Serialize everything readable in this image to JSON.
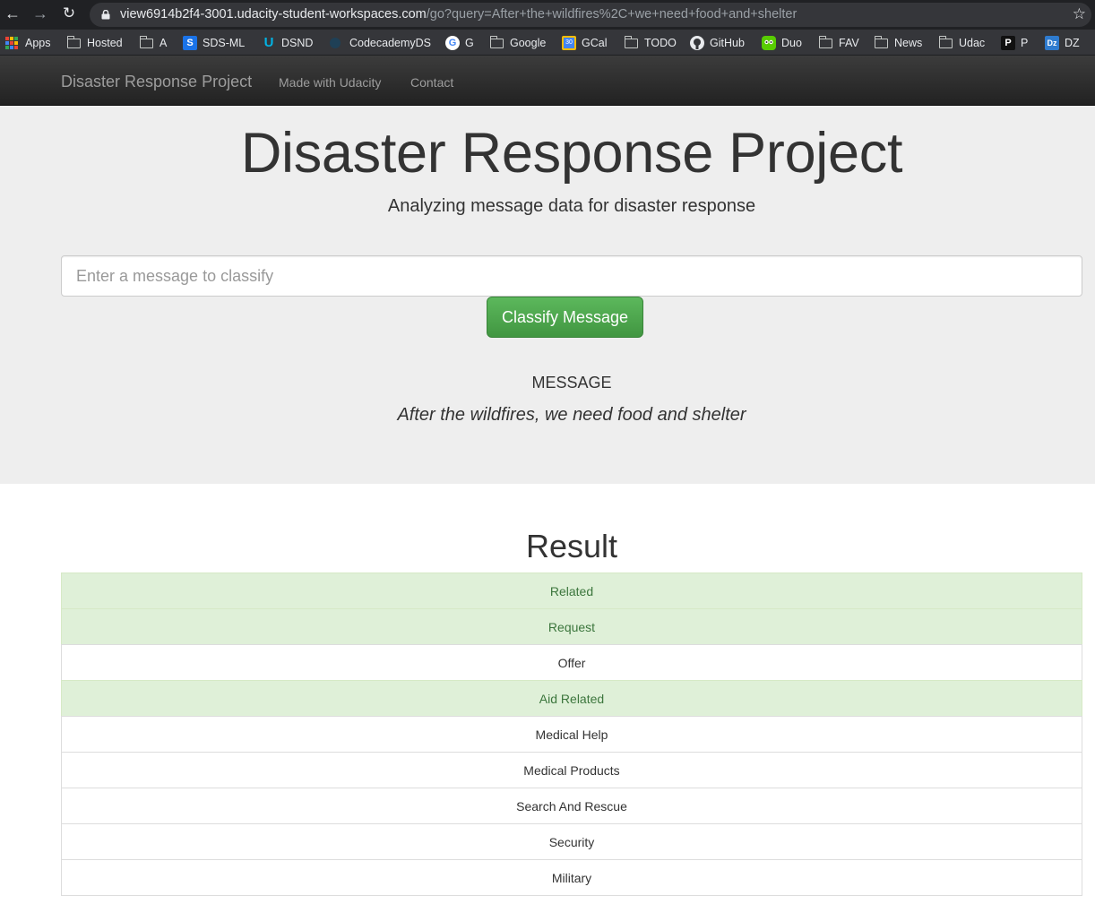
{
  "browser": {
    "url_host": "view6914b2f4-3001.udacity-student-workspaces.com",
    "url_path": "/go?query=After+the+wildfires%2C+we+need+food+and+shelter",
    "bookmarks": [
      {
        "label": "Apps",
        "icon": "apps-grid-icon"
      },
      {
        "label": "Hosted",
        "icon": "folder-icon"
      },
      {
        "label": "A",
        "icon": "folder-icon"
      },
      {
        "label": "SDS-ML",
        "icon": "s-logo-icon"
      },
      {
        "label": "DSND",
        "icon": "udacity-logo-icon"
      },
      {
        "label": "CodecademyDS",
        "icon": "codecademy-logo-icon"
      },
      {
        "label": "G",
        "icon": "google-logo-icon"
      },
      {
        "label": "Google",
        "icon": "folder-icon"
      },
      {
        "label": "GCal",
        "icon": "calendar-icon"
      },
      {
        "label": "TODO",
        "icon": "folder-icon"
      },
      {
        "label": "GitHub",
        "icon": "github-logo-icon"
      },
      {
        "label": "Duo",
        "icon": "duolingo-logo-icon"
      },
      {
        "label": "FAV",
        "icon": "folder-icon"
      },
      {
        "label": "News",
        "icon": "folder-icon"
      },
      {
        "label": "Udac",
        "icon": "folder-icon"
      },
      {
        "label": "P",
        "icon": "p-logo-icon"
      },
      {
        "label": "DZ",
        "icon": "dz-logo-icon"
      }
    ]
  },
  "navbar": {
    "brand": "Disaster Response Project",
    "links": [
      "Made with Udacity",
      "Contact"
    ]
  },
  "jumbotron": {
    "title": "Disaster Response Project",
    "subtitle": "Analyzing message data for disaster response",
    "input_placeholder": "Enter a message to classify",
    "input_value": "",
    "button_label": "Classify Message",
    "message_heading": "MESSAGE",
    "message_text": "After the wildfires, we need food and shelter"
  },
  "result": {
    "title": "Result",
    "categories": [
      {
        "label": "Related",
        "positive": true
      },
      {
        "label": "Request",
        "positive": true
      },
      {
        "label": "Offer",
        "positive": false
      },
      {
        "label": "Aid Related",
        "positive": true
      },
      {
        "label": "Medical Help",
        "positive": false
      },
      {
        "label": "Medical Products",
        "positive": false
      },
      {
        "label": "Search And Rescue",
        "positive": false
      },
      {
        "label": "Security",
        "positive": false
      },
      {
        "label": "Military",
        "positive": false
      }
    ]
  },
  "colors": {
    "positive_bg": "#dff0d8",
    "positive_text": "#3c763d",
    "button_green": "#5cb85c",
    "navbar_dark": "#222222",
    "jumbotron_bg": "#eeeeee"
  }
}
